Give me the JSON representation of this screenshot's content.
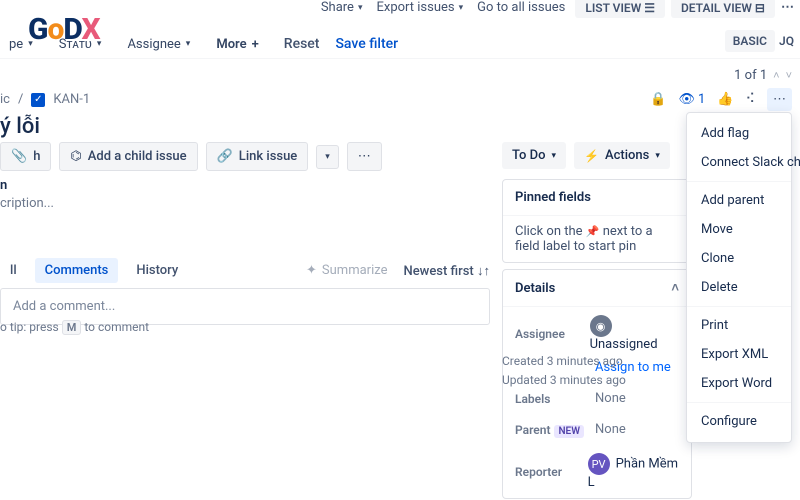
{
  "top": {
    "share": "Share",
    "export": "Export issues",
    "goto": "Go to all issues",
    "list": "LIST VIEW",
    "detail": "DETAIL VIEW"
  },
  "filters": {
    "type": "pe",
    "status": "Sᴛᴀᴛᴜ",
    "assignee": "Assignee",
    "more": "More",
    "reset": "Reset",
    "save": "Save filter"
  },
  "mode": {
    "basic": "BASIC",
    "jql": "JQ"
  },
  "pager": {
    "text": "1 of 1"
  },
  "breadcrumb": {
    "proj": "ic",
    "key": "KAN-1"
  },
  "watch_count": "1",
  "title": "ý lỗi",
  "actions": {
    "attach": "h",
    "addchild": "Add a child issue",
    "link": "Link issue"
  },
  "desc": {
    "head": "n",
    "body": "cription..."
  },
  "tabs": {
    "all": "ll",
    "comments": "Comments",
    "history": "History",
    "summarize": "Summarize",
    "sort": "Newest first"
  },
  "comment_ph": "Add a comment...",
  "protip": {
    "pre": "o tip:",
    "mid": "press",
    "key": "M",
    "post": "to comment"
  },
  "status": {
    "todo": "To Do",
    "actions": "Actions"
  },
  "pinned": {
    "title": "Pinned fields",
    "hint_pre": "Click on the",
    "hint_post": "next to a field label to start pin"
  },
  "details": {
    "title": "Details",
    "assignee": {
      "lbl": "Assignee",
      "val": "Unassigned",
      "link": "Assign to me"
    },
    "labels": {
      "lbl": "Labels",
      "val": "None"
    },
    "parent": {
      "lbl": "Parent",
      "new": "NEW",
      "val": "None"
    },
    "reporter": {
      "lbl": "Reporter",
      "val": "Phần Mềm L",
      "initials": "PV"
    }
  },
  "meta": {
    "created": "Created 3 minutes ago",
    "updated": "Updated 3 minutes ago"
  },
  "menu": {
    "addflag": "Add flag",
    "slack": "Connect Slack channel",
    "addparent": "Add parent",
    "move": "Move",
    "clone": "Clone",
    "delete": "Delete",
    "print": "Print",
    "xml": "Export XML",
    "word": "Export Word",
    "configure": "Configure"
  }
}
